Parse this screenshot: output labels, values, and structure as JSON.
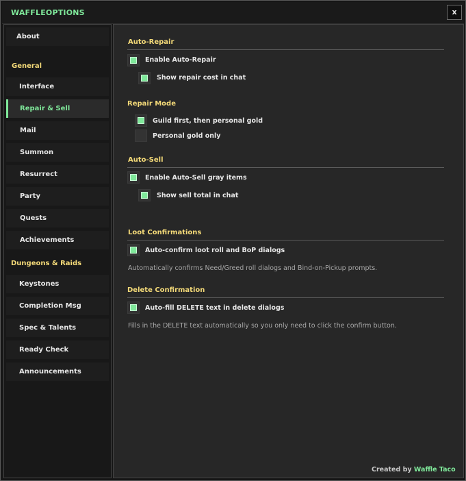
{
  "window": {
    "title": "WAFFLEOPTIONS",
    "close_label": "x"
  },
  "colors": {
    "accent": "#7fe89a",
    "category": "#f3d978",
    "text": "#e6e6e6",
    "muted": "#a8a8a8"
  },
  "sidebar": {
    "about": "About",
    "general": {
      "label": "General",
      "items": [
        "Interface",
        "Repair & Sell",
        "Mail",
        "Summon",
        "Resurrect",
        "Party",
        "Quests",
        "Achievements"
      ]
    },
    "dungeons": {
      "label": "Dungeons & Raids",
      "items": [
        "Keystones",
        "Completion Msg",
        "Spec & Talents",
        "Ready Check",
        "Announcements"
      ]
    },
    "active": "Repair & Sell"
  },
  "sections": {
    "auto_repair": {
      "title": "Auto-Repair",
      "enable": {
        "label": "Enable Auto-Repair",
        "checked": true
      },
      "show_cost": {
        "label": "Show repair cost in chat",
        "checked": true
      }
    },
    "repair_mode": {
      "title": "Repair Mode",
      "guild_first": {
        "label": "Guild first, then personal gold",
        "checked": true
      },
      "personal_only": {
        "label": "Personal gold only",
        "checked": false
      }
    },
    "auto_sell": {
      "title": "Auto-Sell",
      "enable": {
        "label": "Enable Auto-Sell gray items",
        "checked": true
      },
      "show_total": {
        "label": "Show sell total in chat",
        "checked": true
      }
    },
    "loot": {
      "title": "Loot Confirmations",
      "auto_confirm": {
        "label": "Auto-confirm loot roll and BoP dialogs",
        "checked": true
      },
      "description": "Automatically confirms Need/Greed roll dialogs and Bind-on-Pickup prompts."
    },
    "delete": {
      "title": "Delete Confirmation",
      "auto_fill": {
        "label": "Auto-fill DELETE text in delete dialogs",
        "checked": true
      },
      "description": "Fills in the DELETE text automatically so you only need to click the confirm button."
    }
  },
  "footer": {
    "prefix": "Created by",
    "author": "Waffle Taco"
  }
}
